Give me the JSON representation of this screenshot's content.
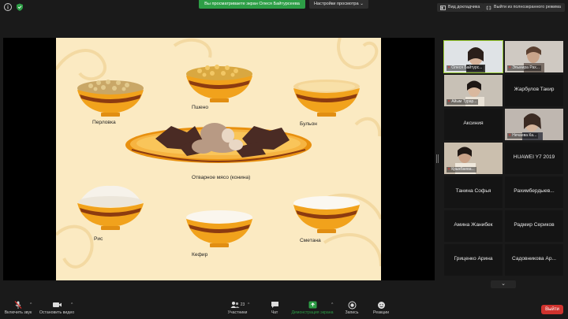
{
  "topbar": {
    "share_banner": "Вы просматриваете экран Олеся Байтурсеева",
    "view_settings": "Настройки просмотра",
    "gallery_view_button": "Вид докладчика",
    "exit_fullscreen_button": "Выйти из полноэкранного режима"
  },
  "slide": {
    "labels": {
      "perlovka": "Перловка",
      "psheno": "Пшено",
      "bulyon": "Бульон",
      "meat": "Отварное мясо (конина)",
      "ris": "Рис",
      "kefir": "Кефир",
      "smetana": "Сметана"
    }
  },
  "gallery": {
    "participants": [
      "Олеся Байтурс...",
      "Эльмира Рах...",
      "Айым Турар...",
      "Жарбулов Такир",
      "Аксиния",
      "Нечаева Ка...",
      "Крыкбаева...",
      "HUAWEI Y7 2019",
      "Танина Софья",
      "Рахимбердыев...",
      "Амина Жанибек",
      "Радмир Сериков",
      "Гриценко Арина",
      "Садовникова Ар..."
    ]
  },
  "toolbar": {
    "unmute": "Включить звук",
    "stop_video": "Остановить видео",
    "participants": "Участники",
    "participants_count": "23",
    "chat": "Чат",
    "share_screen": "Демонстрация экрана",
    "record": "Запись",
    "reactions": "Реакции",
    "leave": "Выйти"
  }
}
